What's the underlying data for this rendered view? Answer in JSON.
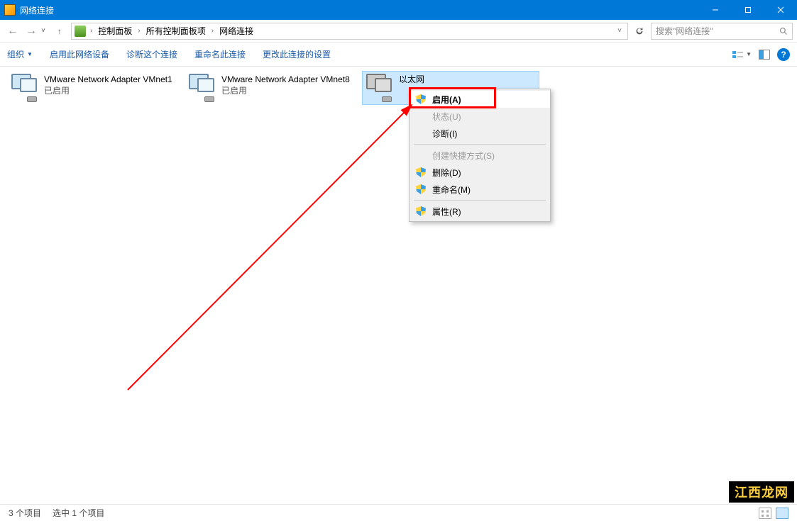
{
  "window": {
    "title": "网络连接"
  },
  "breadcrumb": {
    "root": "控制面板",
    "mid": "所有控制面板项",
    "leaf": "网络连接"
  },
  "search": {
    "placeholder": "搜索\"网络连接\""
  },
  "toolbar": {
    "organize": "组织",
    "enable": "启用此网络设备",
    "diagnose": "诊断这个连接",
    "rename": "重命名此连接",
    "change": "更改此连接的设置"
  },
  "adapters": [
    {
      "name": "VMware Network Adapter VMnet1",
      "status": "已启用"
    },
    {
      "name": "VMware Network Adapter VMnet8",
      "status": "已启用"
    },
    {
      "name": "以太网",
      "status": ""
    }
  ],
  "context_menu": {
    "enable": "启用(A)",
    "status": "状态(U)",
    "diagnose": "诊断(I)",
    "shortcut": "创建快捷方式(S)",
    "delete": "删除(D)",
    "rename": "重命名(M)",
    "properties": "属性(R)"
  },
  "statusbar": {
    "count": "3 个项目",
    "selected": "选中 1 个项目"
  },
  "watermark": "江西龙网"
}
